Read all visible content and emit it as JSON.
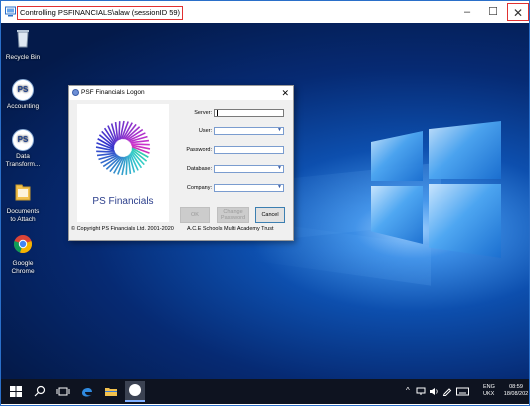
{
  "window": {
    "title": "Controlling PSFINANCIALS\\alaw (sessionID 59)",
    "min_glyph": "–",
    "max_glyph": "☐",
    "close_glyph": "✕"
  },
  "desktop_icons": [
    {
      "label": "Recycle Bin",
      "icon": "recycle-bin-icon"
    },
    {
      "label": "Accounting",
      "icon": "ps-icon"
    },
    {
      "label": "Data Transform...",
      "icon": "ps-icon"
    },
    {
      "label": "Documents to Attach",
      "icon": "folder-icon"
    },
    {
      "label": "Google Chrome",
      "icon": "chrome-icon"
    }
  ],
  "ps_icon_text": "PS",
  "dialog": {
    "title": "PSF Financials Logon",
    "close_glyph": "✕",
    "logo_text": "PS Financials",
    "copyright": "© Copyright PS Financials Ltd. 2001-2020",
    "trust": "A.C.E Schools Multi Academy Trust",
    "labels": {
      "server": "Server:",
      "user": "User:",
      "password": "Password:",
      "database": "Database:",
      "company": "Company:"
    },
    "buttons": {
      "ok": "OK",
      "change_password_1": "Change",
      "change_password_2": "Password",
      "cancel": "Cancel"
    }
  },
  "taskbar": {
    "lang_1": "ENG",
    "lang_2": "UKX",
    "time": "08:59",
    "date": "18/08/202"
  },
  "colors": {
    "accent": "#2a6fc9",
    "highlight": "#e03131",
    "taskbar": "#0e1320"
  }
}
